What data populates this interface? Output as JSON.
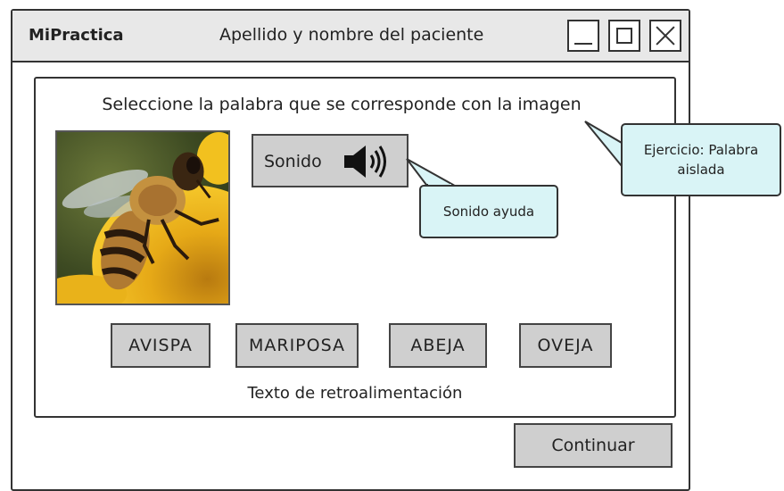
{
  "window": {
    "app_name": "MiPractica",
    "title": "Apellido y nombre del paciente"
  },
  "exercise": {
    "instruction": "Seleccione la palabra que se corresponde con la imagen",
    "image": "bee-on-flower",
    "sound_label": "Sonido",
    "sound_icon": "speaker-icon",
    "options": [
      "AVISPA",
      "MARIPOSA",
      "ABEJA",
      "OVEJA"
    ],
    "feedback": "Texto de retroalimentación"
  },
  "footer": {
    "continue_label": "Continuar"
  },
  "annotations": {
    "sound_help": "Sonido ayuda",
    "exercise_type": "Ejercicio: Palabra aislada"
  },
  "colors": {
    "button_fill": "#cfcfcf",
    "callout_fill": "#d9f4f6",
    "titlebar_fill": "#e8e8e8"
  }
}
